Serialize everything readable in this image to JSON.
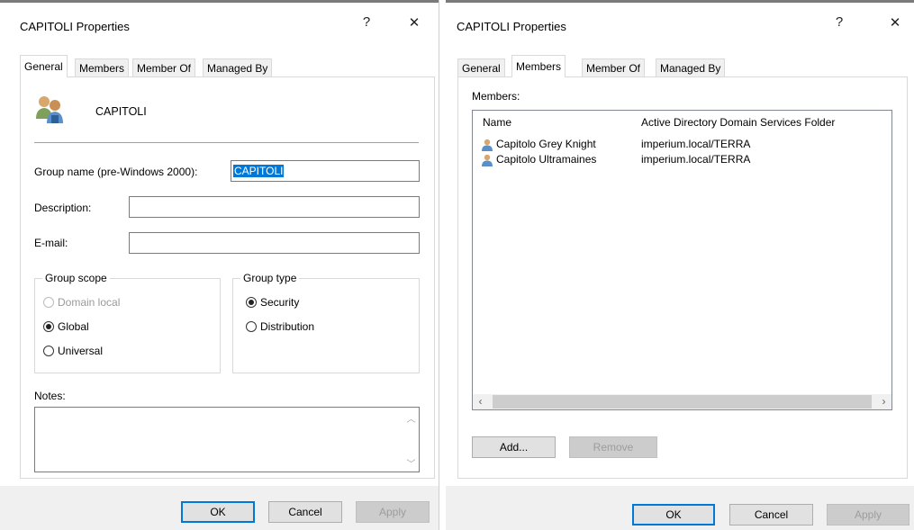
{
  "left": {
    "window_title": "CAPITOLI Properties",
    "help_glyph": "?",
    "close_glyph": "✕",
    "tabs": [
      "General",
      "Members",
      "Member Of",
      "Managed By"
    ],
    "group_name_display": "CAPITOLI",
    "group_name_label": "Group name (pre-Windows 2000):",
    "group_name_value": "CAPITOLI",
    "description_label": "Description:",
    "description_value": "",
    "email_label": "E-mail:",
    "email_value": "",
    "group_scope": {
      "legend": "Group scope",
      "options": [
        "Domain local",
        "Global",
        "Universal"
      ],
      "selected": "Global"
    },
    "group_type": {
      "legend": "Group type",
      "options": [
        "Security",
        "Distribution"
      ],
      "selected": "Security"
    },
    "notes_label": "Notes:",
    "notes_value": "",
    "buttons": {
      "ok": "OK",
      "cancel": "Cancel",
      "apply": "Apply"
    }
  },
  "right": {
    "window_title": "CAPITOLI Properties",
    "help_glyph": "?",
    "close_glyph": "✕",
    "tabs": [
      "General",
      "Members",
      "Member Of",
      "Managed By"
    ],
    "members_label": "Members:",
    "columns": [
      "Name",
      "Active Directory Domain Services Folder"
    ],
    "rows": [
      {
        "name": "Capitolo Grey Knight",
        "folder": "imperium.local/TERRA"
      },
      {
        "name": "Capitolo Ultramaines",
        "folder": "imperium.local/TERRA"
      }
    ],
    "add_label": "Add...",
    "remove_label": "Remove",
    "buttons": {
      "ok": "OK",
      "cancel": "Cancel",
      "apply": "Apply"
    }
  },
  "colors": {
    "selection": "#0078d7",
    "default_button_border": "#0078d7"
  }
}
